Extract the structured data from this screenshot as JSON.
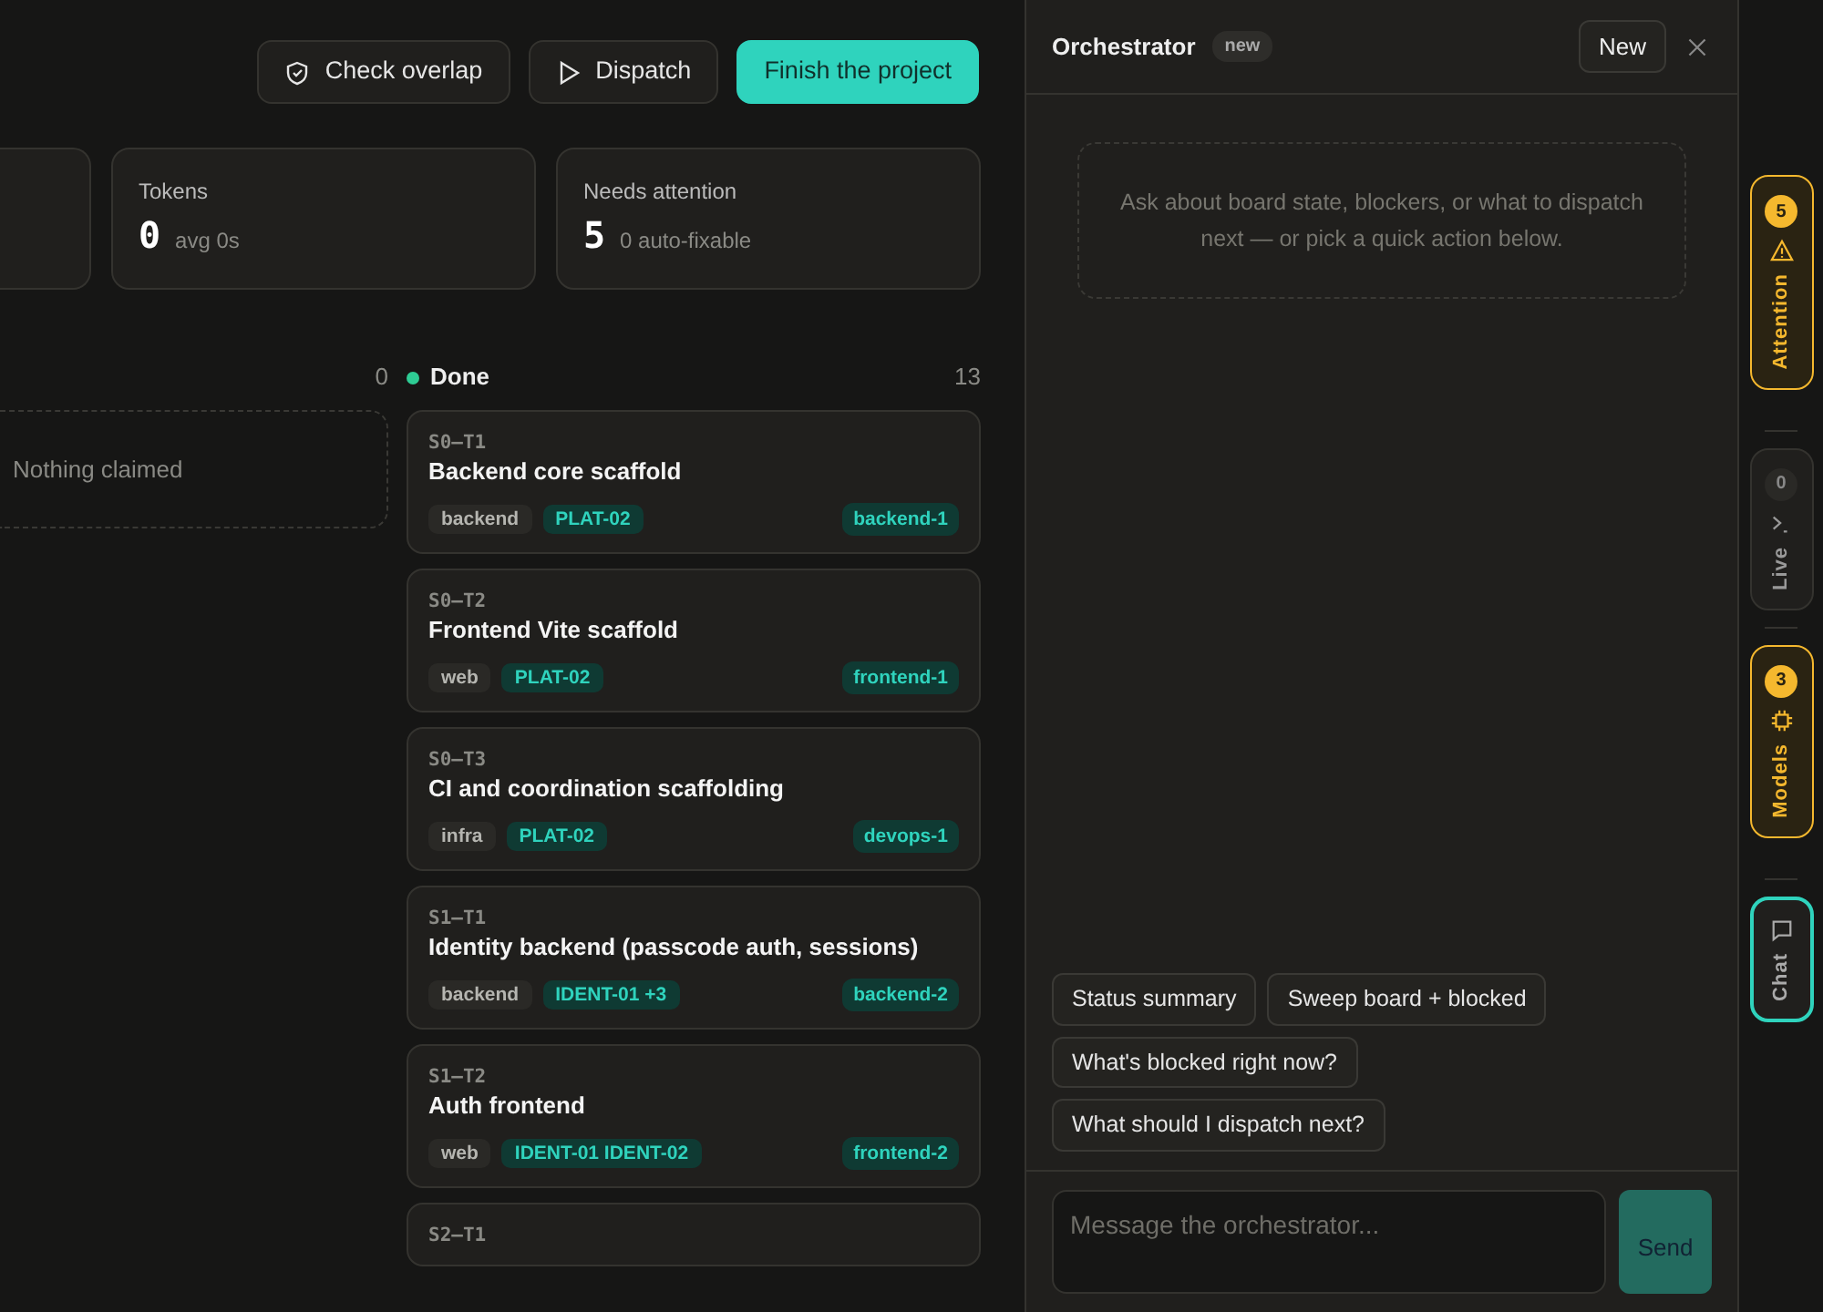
{
  "toolbar": {
    "buttons": [
      {
        "label": "Check overlap",
        "kind": "outline"
      },
      {
        "label": "Dispatch",
        "kind": "outline"
      },
      {
        "label": "Finish the project",
        "kind": "primary"
      }
    ]
  },
  "stats": [
    {
      "label": "Tokens",
      "value": "0",
      "note": "avg 0s"
    },
    {
      "label": "Needs attention",
      "value": "5",
      "note": "0 auto-fixable"
    }
  ],
  "columns": [
    {
      "count": "0",
      "empty": "Nothing claimed"
    },
    {
      "name": "Done",
      "color": "#2ecc94",
      "count": "13",
      "cards": [
        {
          "id": "S0–T1",
          "title": "Backend core scaffold",
          "tags": [
            {
              "label": "backend",
              "kind": "area"
            },
            {
              "label": "PLAT-02",
              "kind": "req"
            }
          ],
          "agent": "backend-1"
        },
        {
          "id": "S0–T2",
          "title": "Frontend Vite scaffold",
          "tags": [
            {
              "label": "web",
              "kind": "area"
            },
            {
              "label": "PLAT-02",
              "kind": "req"
            }
          ],
          "agent": "frontend-1"
        },
        {
          "id": "S0–T3",
          "title": "CI and coordination scaffolding",
          "tags": [
            {
              "label": "infra",
              "kind": "area"
            },
            {
              "label": "PLAT-02",
              "kind": "req"
            }
          ],
          "agent": "devops-1"
        },
        {
          "id": "S1–T1",
          "title": "Identity backend (passcode auth, sessions)",
          "tags": [
            {
              "label": "backend",
              "kind": "area"
            },
            {
              "label": "IDENT-01 +3",
              "kind": "req"
            }
          ],
          "agent": "backend-2"
        },
        {
          "id": "S1–T2",
          "title": "Auth frontend",
          "tags": [
            {
              "label": "web",
              "kind": "area"
            },
            {
              "label": "IDENT-01 IDENT-02",
              "kind": "req"
            }
          ],
          "agent": "frontend-2"
        },
        {
          "id": "S2–T1"
        }
      ]
    }
  ],
  "panel": {
    "title": "Orchestrator",
    "badge": "new",
    "new_button": "New",
    "hint": "Ask about board state, blockers, or what to dispatch next — or pick a quick action below.",
    "quick_actions": [
      "Status summary",
      "Sweep board + blocked",
      "What's blocked right now?",
      "What should I dispatch next?"
    ],
    "input": {
      "placeholder": "Message the orchestrator..."
    },
    "send": "Send"
  },
  "rail": [
    {
      "label": "Attention",
      "count": "5",
      "kind": "alert",
      "selected": false
    },
    {
      "label": "Live",
      "count": "0",
      "kind": "idle",
      "selected": false
    },
    {
      "label": "Models",
      "count": "3",
      "kind": "alert",
      "selected": false
    },
    {
      "label": "Chat",
      "kind": "idle",
      "selected": true
    }
  ]
}
